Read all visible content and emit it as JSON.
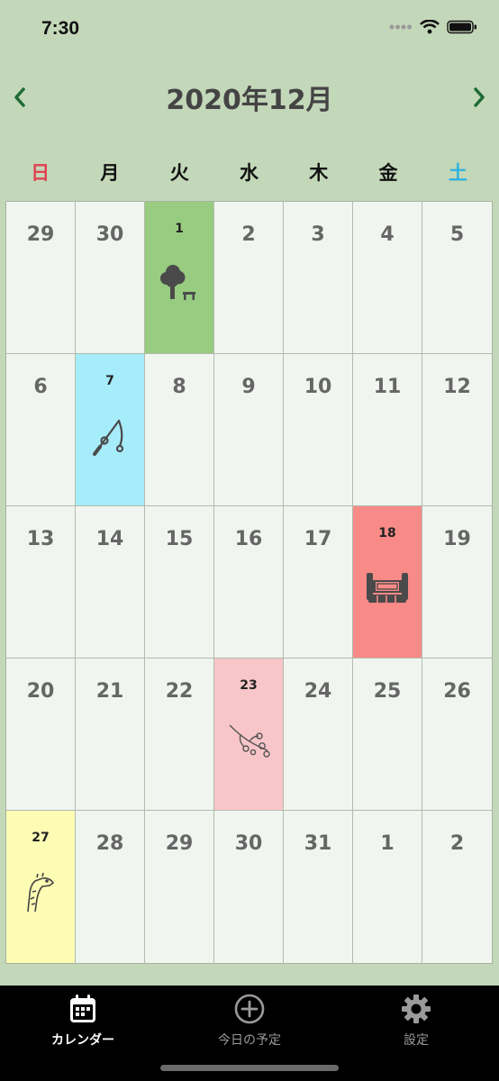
{
  "status_bar": {
    "time": "7:30"
  },
  "header": {
    "title": "2020年12月",
    "prev_icon": "chevron-left-icon",
    "next_icon": "chevron-right-icon"
  },
  "weekdays": [
    "日",
    "月",
    "火",
    "水",
    "木",
    "金",
    "土"
  ],
  "colors": {
    "sunday": "#e0434f",
    "saturday": "#2bb2e0",
    "nav_arrow": "#1e6b35",
    "event_green": "#98cc81",
    "event_blue": "#a6ecfb",
    "event_red": "#f88a87",
    "event_pink": "#f8c6c8",
    "event_yellow": "#fcfcb5"
  },
  "days": [
    {
      "label": "29"
    },
    {
      "label": "30"
    },
    {
      "label": "1",
      "event": "tree-bench-icon",
      "color": "#98cc81"
    },
    {
      "label": "2"
    },
    {
      "label": "3"
    },
    {
      "label": "4"
    },
    {
      "label": "5"
    },
    {
      "label": "6"
    },
    {
      "label": "7",
      "event": "fishing-rod-icon",
      "color": "#a6ecfb"
    },
    {
      "label": "8"
    },
    {
      "label": "9"
    },
    {
      "label": "10"
    },
    {
      "label": "11"
    },
    {
      "label": "12"
    },
    {
      "label": "13"
    },
    {
      "label": "14"
    },
    {
      "label": "15"
    },
    {
      "label": "16"
    },
    {
      "label": "17"
    },
    {
      "label": "18",
      "event": "game-controller-icon",
      "color": "#f88a87"
    },
    {
      "label": "19"
    },
    {
      "label": "20"
    },
    {
      "label": "21"
    },
    {
      "label": "22"
    },
    {
      "label": "23",
      "event": "cherry-blossom-icon",
      "color": "#f8c6c8"
    },
    {
      "label": "24"
    },
    {
      "label": "25"
    },
    {
      "label": "26"
    },
    {
      "label": "27",
      "event": "giraffe-icon",
      "color": "#fcfcb5"
    },
    {
      "label": "28"
    },
    {
      "label": "29"
    },
    {
      "label": "30"
    },
    {
      "label": "31"
    },
    {
      "label": "1"
    },
    {
      "label": "2"
    }
  ],
  "tabs": [
    {
      "label": "カレンダー",
      "icon": "calendar-icon",
      "active": true
    },
    {
      "label": "今日の予定",
      "icon": "plus-circle-icon",
      "active": false
    },
    {
      "label": "設定",
      "icon": "gear-icon",
      "active": false
    }
  ]
}
